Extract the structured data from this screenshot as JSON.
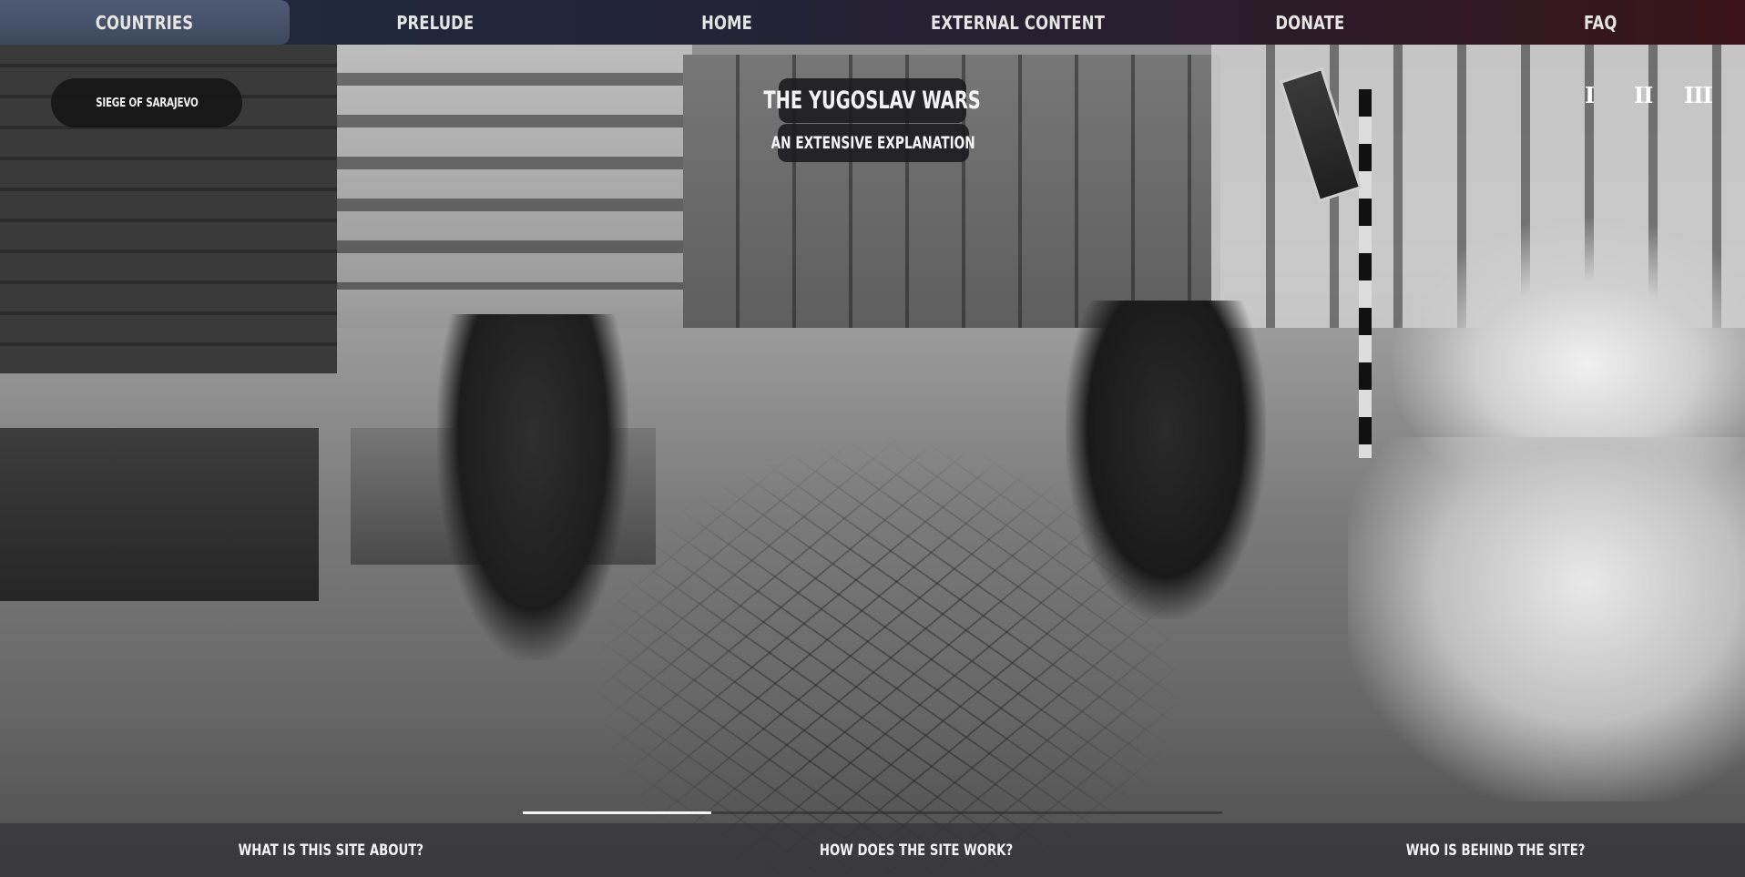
{
  "nav": {
    "tabs": [
      {
        "label": "COUNTRIES",
        "active": true
      },
      {
        "label": "PRELUDE",
        "active": false
      },
      {
        "label": "HOME",
        "active": false
      },
      {
        "label": "EXTERNAL CONTENT",
        "active": false
      },
      {
        "label": "DONATE",
        "active": false
      },
      {
        "label": "FAQ",
        "active": false
      }
    ]
  },
  "hero": {
    "location_label": "SIEGE OF SARAJEVO",
    "title": "THE YUGOSLAV WARS",
    "subtitle": "AN EXTENSIVE EXPLANATION",
    "slide_indicators": [
      "I",
      "II",
      "III"
    ],
    "progress_fraction": 0.27
  },
  "footer": {
    "links": [
      "WHAT IS THIS SITE ABOUT?",
      "HOW DOES THE SITE WORK?",
      "WHO IS BEHIND THE SITE?"
    ]
  },
  "colors": {
    "nav_start": "#1e2a3e",
    "nav_end": "#3a1418",
    "active_tab": "#4e5b73",
    "pill_bg": "#141416",
    "text": "#f4f4f4"
  }
}
